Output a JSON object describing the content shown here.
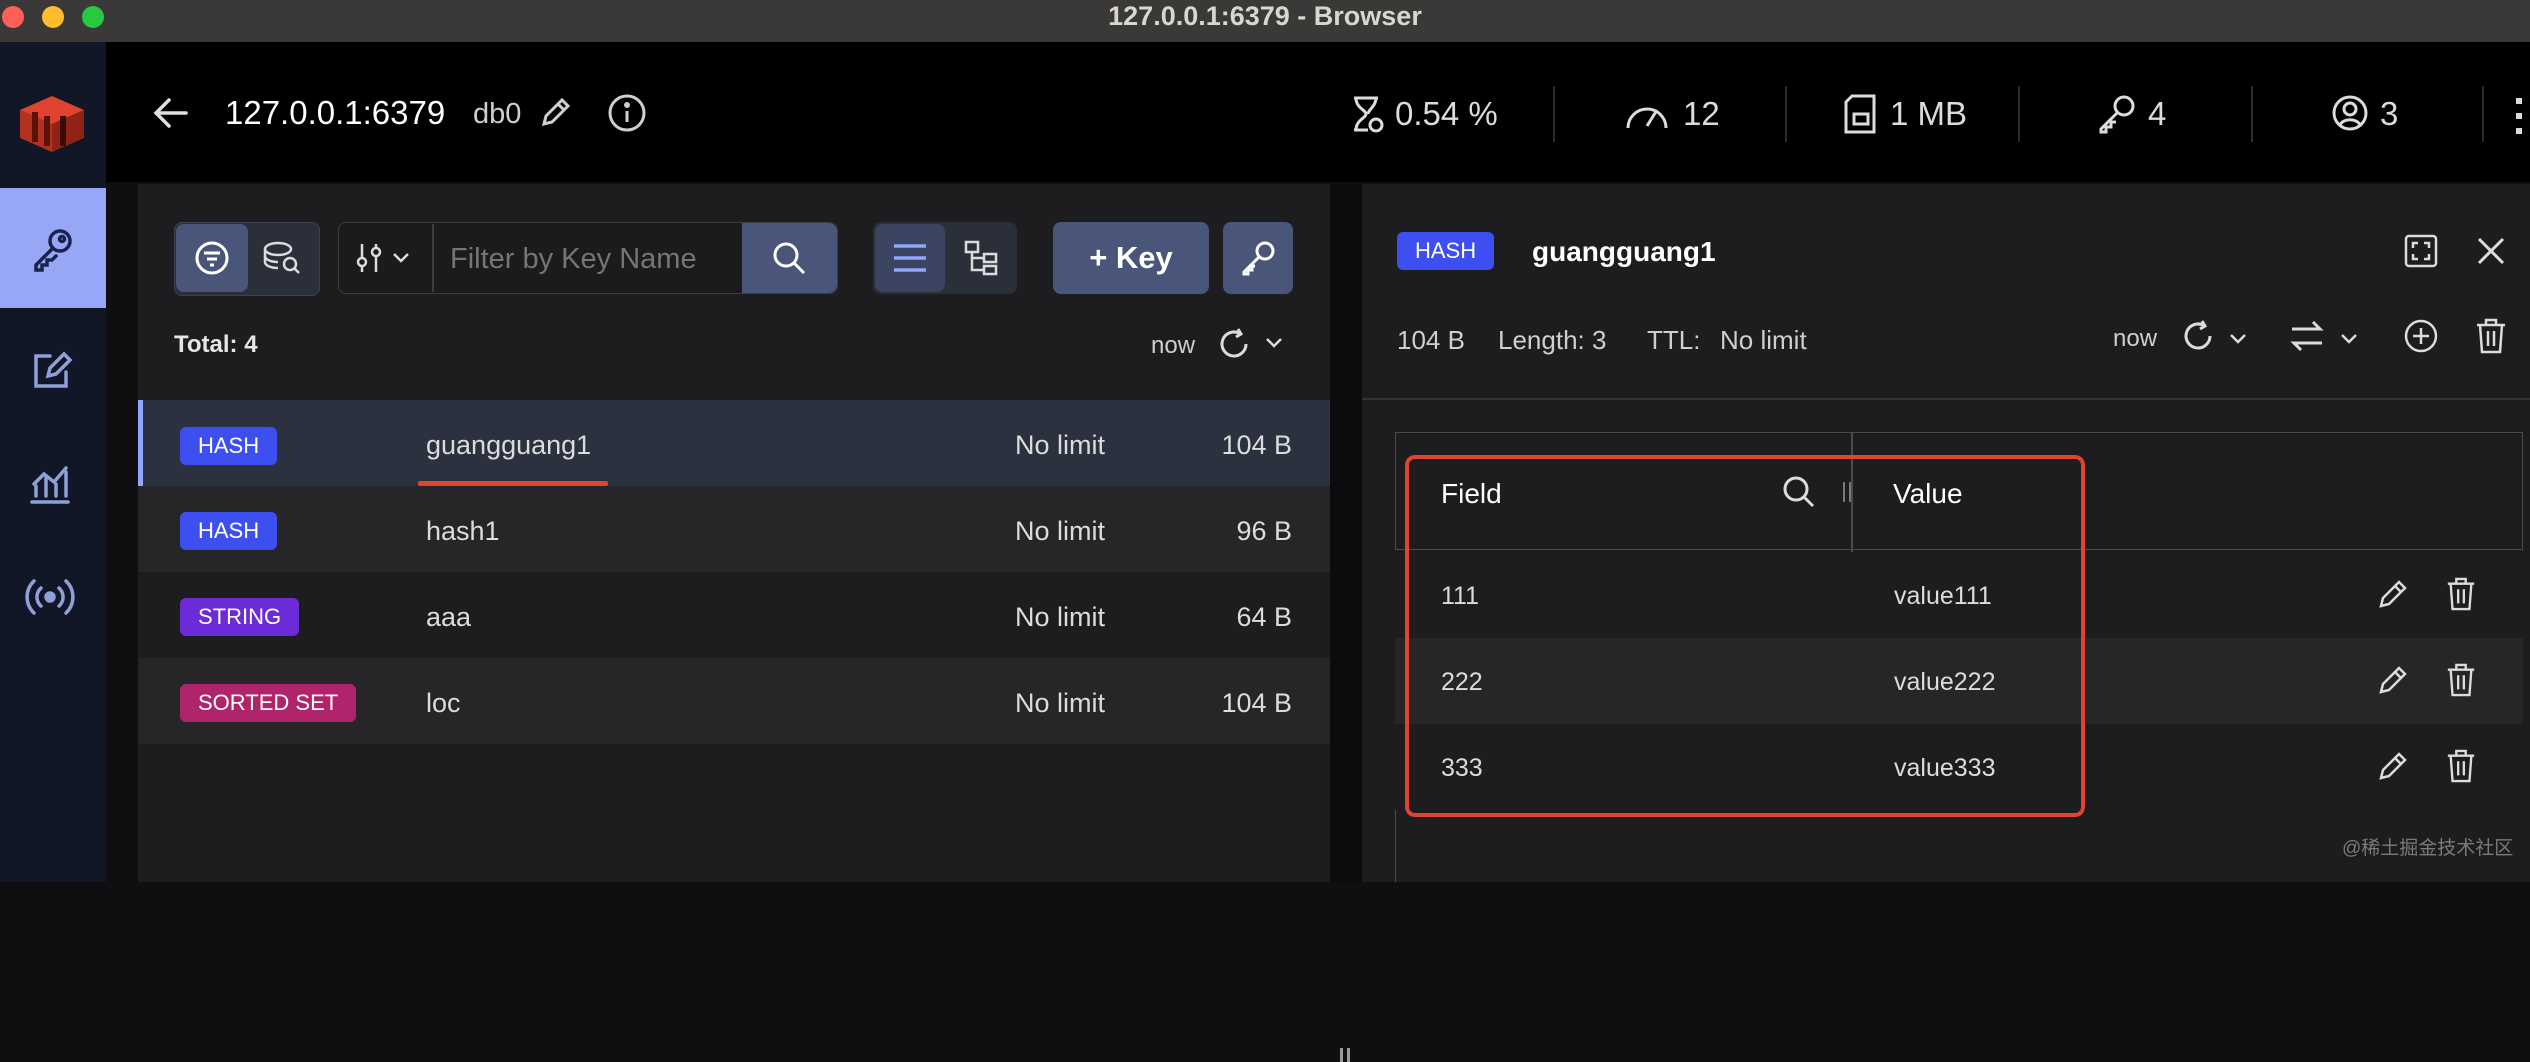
{
  "window": {
    "title": "127.0.0.1:6379 - Browser"
  },
  "header": {
    "host": "127.0.0.1:6379",
    "db": "db0",
    "stats": {
      "cpu": "0.54 %",
      "ops": "12",
      "memory": "1 MB",
      "keys": "4",
      "clients": "3"
    }
  },
  "toolbar": {
    "filter_placeholder": "Filter by Key Name",
    "add_key_label": "+ Key"
  },
  "list": {
    "total": "Total: 4",
    "refresh_label": "now",
    "rows": [
      {
        "type": "HASH",
        "type_color": "#3d4ff0",
        "name": "guangguang1",
        "ttl": "No limit",
        "size": "104 B"
      },
      {
        "type": "HASH",
        "type_color": "#3d4ff0",
        "name": "hash1",
        "ttl": "No limit",
        "size": "96 B"
      },
      {
        "type": "STRING",
        "type_color": "#6b2bd6",
        "name": "aaa",
        "ttl": "No limit",
        "size": "64 B"
      },
      {
        "type": "SORTED SET",
        "type_color": "#b0246b",
        "name": "loc",
        "ttl": "No limit",
        "size": "104 B"
      }
    ]
  },
  "details": {
    "type": "HASH",
    "key": "guangguang1",
    "size": "104 B",
    "length": "Length: 3",
    "ttl_label": "TTL:",
    "ttl_value": "No limit",
    "refresh_label": "now",
    "columns": {
      "field": "Field",
      "value": "Value"
    },
    "rows": [
      {
        "field": "111",
        "value": "value111"
      },
      {
        "field": "222",
        "value": "value222"
      },
      {
        "field": "333",
        "value": "value333"
      }
    ]
  },
  "watermark": "@稀土掘金技术社区"
}
